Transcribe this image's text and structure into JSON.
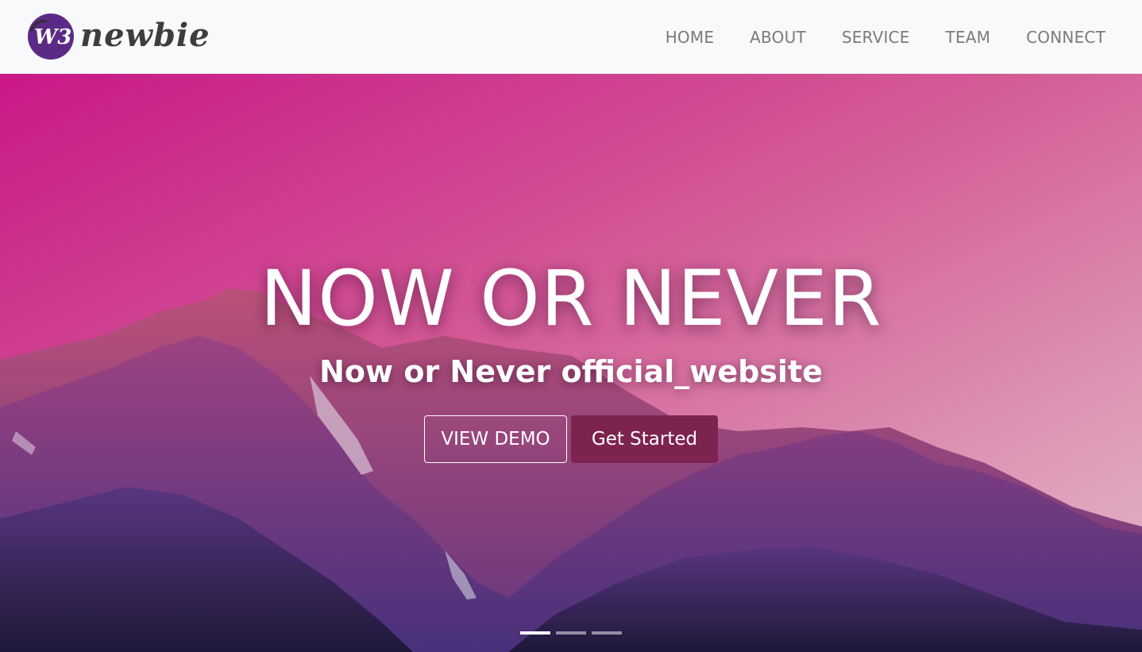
{
  "brand": {
    "logo_mark_text": "W3",
    "wordmark": "newbie",
    "logo_color": "#5b2a86"
  },
  "nav": {
    "items": [
      "HOME",
      "ABOUT",
      "SERVICE",
      "TEAM",
      "CONNECT"
    ]
  },
  "hero": {
    "title": "NOW OR NEVER",
    "subtitle": "Now or Never official_website",
    "view_demo_label": "VIEW DEMO",
    "get_started_label": "Get Started",
    "accent_color": "#7d2350",
    "background": "pink-to-violet sky over purple mountain range"
  },
  "carousel": {
    "slide_count": 3,
    "active_index": 0
  }
}
